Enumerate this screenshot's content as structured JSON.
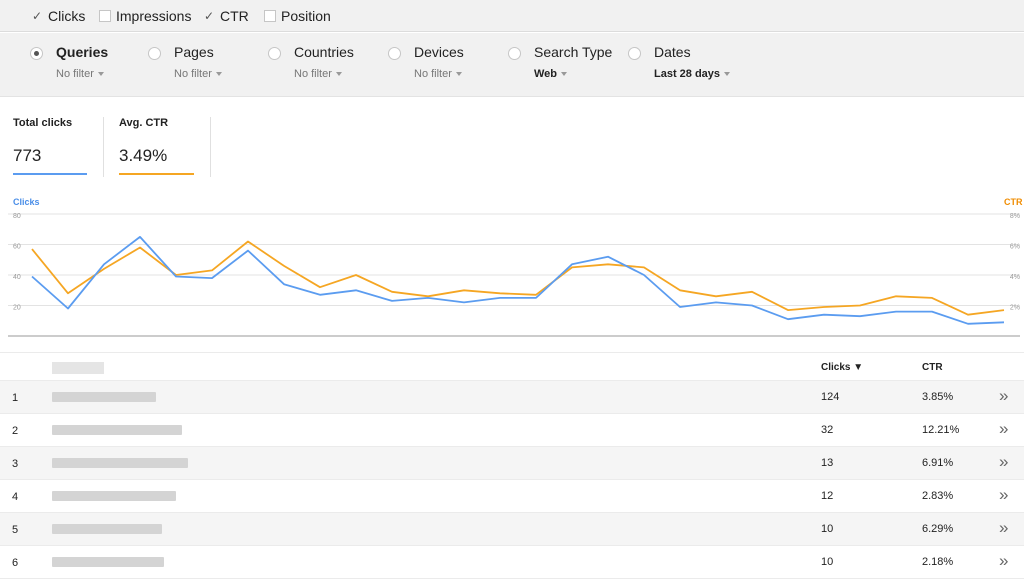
{
  "metrics": [
    {
      "label": "Clicks",
      "checked": true
    },
    {
      "label": "Impressions",
      "checked": false
    },
    {
      "label": "CTR",
      "checked": true
    },
    {
      "label": "Position",
      "checked": false
    }
  ],
  "checkmark": "✓",
  "filters": [
    {
      "title": "Queries",
      "value": "No filter",
      "selected": true
    },
    {
      "title": "Pages",
      "value": "No filter",
      "selected": false
    },
    {
      "title": "Countries",
      "value": "No filter",
      "selected": false
    },
    {
      "title": "Devices",
      "value": "No filter",
      "selected": false
    },
    {
      "title": "Search Type",
      "value": "Web",
      "selected": false
    },
    {
      "title": "Dates",
      "value": "Last 28 days",
      "selected": false
    }
  ],
  "totals": {
    "clicks_label": "Total clicks",
    "clicks_value": "773",
    "ctr_label": "Avg. CTR",
    "ctr_value": "3.49%"
  },
  "colors": {
    "clicks": "#5b9cf0",
    "ctr": "#f5a623",
    "clicks_title": "#4a8ee8",
    "ctr_title": "#f08c00"
  },
  "chart_data": {
    "type": "line",
    "left_axis_title": "Clicks",
    "right_axis_title": "CTR",
    "left_ticks": [
      "80",
      "60",
      "40",
      "20"
    ],
    "right_ticks": [
      "8%",
      "6%",
      "4%",
      "2%"
    ],
    "ylim_left": [
      0,
      80
    ],
    "ylim_right": [
      0,
      8
    ],
    "grid": true,
    "series": [
      {
        "name": "Clicks",
        "axis": "left",
        "values": [
          39,
          18,
          47,
          65,
          39,
          38,
          56,
          34,
          27,
          30,
          23,
          25,
          22,
          25,
          25,
          47,
          52,
          40,
          19,
          22,
          20,
          11,
          14,
          13,
          16,
          16,
          8,
          9
        ]
      },
      {
        "name": "CTR",
        "axis": "right",
        "values": [
          5.7,
          2.8,
          4.4,
          5.8,
          4.0,
          4.3,
          6.2,
          4.6,
          3.2,
          4.0,
          2.9,
          2.6,
          3.0,
          2.8,
          2.7,
          4.5,
          4.7,
          4.5,
          3.0,
          2.6,
          2.9,
          1.7,
          1.9,
          2.0,
          2.6,
          2.5,
          1.4,
          1.7
        ]
      }
    ]
  },
  "table": {
    "col_clicks": "Clicks ▼",
    "col_ctr": "CTR",
    "more_icon": "»",
    "rows": [
      {
        "rank": "1",
        "clicks": "124",
        "ctr": "3.85%"
      },
      {
        "rank": "2",
        "clicks": "32",
        "ctr": "12.21%"
      },
      {
        "rank": "3",
        "clicks": "13",
        "ctr": "6.91%"
      },
      {
        "rank": "4",
        "clicks": "12",
        "ctr": "2.83%"
      },
      {
        "rank": "5",
        "clicks": "10",
        "ctr": "6.29%"
      },
      {
        "rank": "6",
        "clicks": "10",
        "ctr": "2.18%"
      }
    ]
  }
}
